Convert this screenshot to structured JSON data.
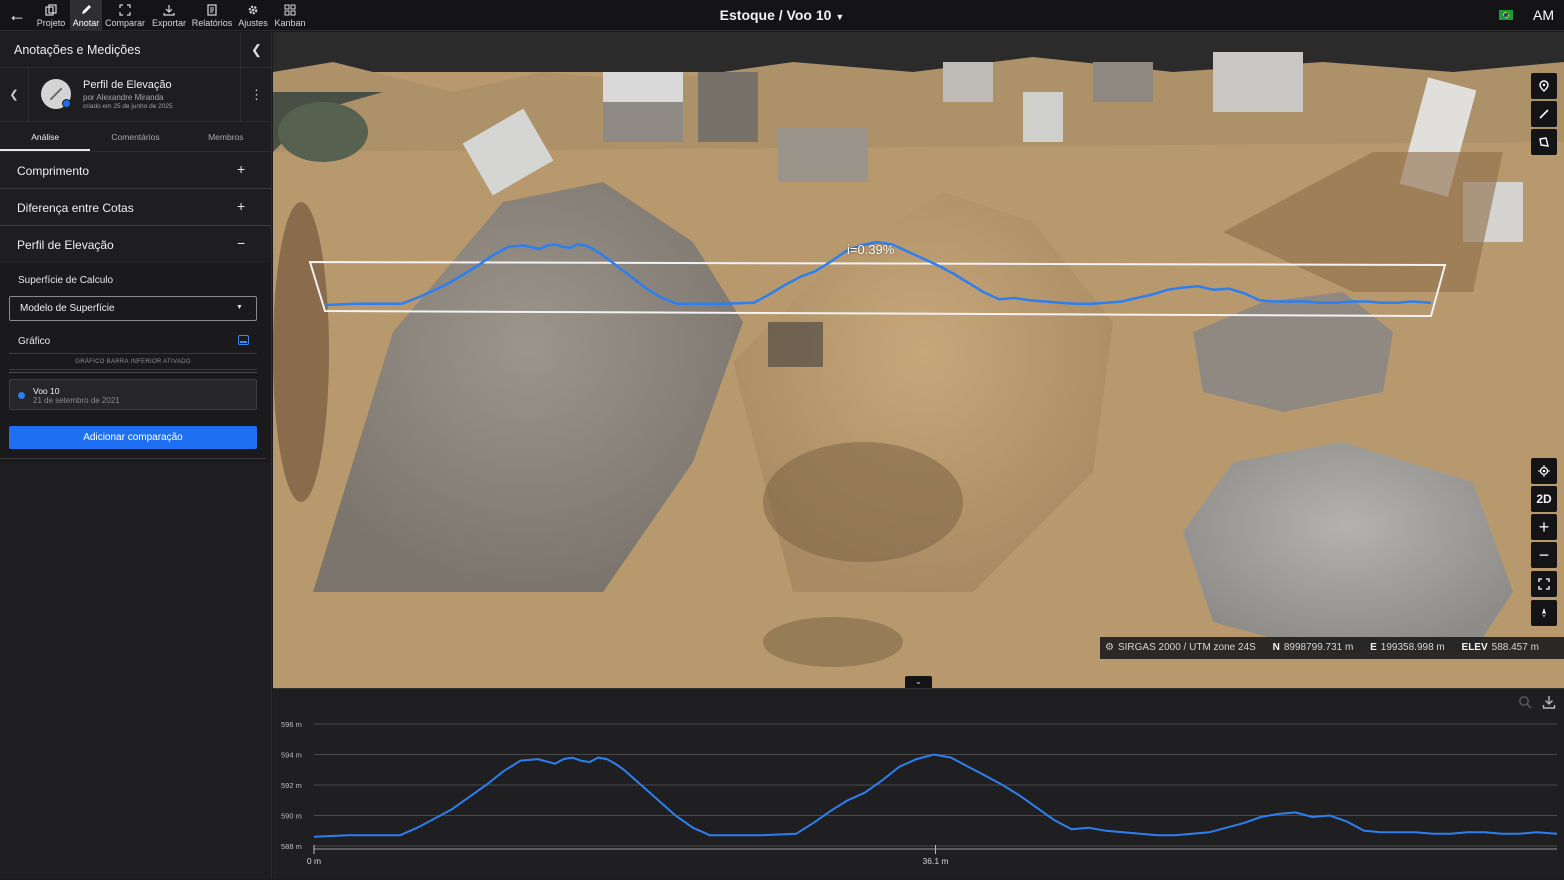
{
  "topbar": {
    "tools": [
      {
        "id": "projeto",
        "label": "Projeto",
        "icon": "copy-icon"
      },
      {
        "id": "anotar",
        "label": "Anotar",
        "icon": "pencil-icon",
        "active": true
      },
      {
        "id": "comparar",
        "label": "Comparar",
        "icon": "compare-icon"
      },
      {
        "id": "exportar",
        "label": "Exportar",
        "icon": "download-icon"
      },
      {
        "id": "relatorios",
        "label": "Relatórios",
        "icon": "report-icon"
      },
      {
        "id": "ajustes",
        "label": "Ajustes",
        "icon": "gear-icon"
      },
      {
        "id": "kanban",
        "label": "Kanban",
        "icon": "grid-icon"
      }
    ],
    "title": "Estoque / Voo 10",
    "avatar": "AM"
  },
  "sidebar": {
    "title": "Anotações e Medições",
    "annotation": {
      "name": "Perfil de Elevação",
      "author": "por  Alexandre Miranda",
      "created": "criado em 25 de junho de 2025"
    },
    "tabs": [
      {
        "label": "Análise",
        "active": true
      },
      {
        "label": "Comentários"
      },
      {
        "label": "Membros"
      }
    ],
    "sections": [
      {
        "label": "Comprimento",
        "sign": "+"
      },
      {
        "label": "Diferença entre Cotas",
        "sign": "+"
      },
      {
        "label": "Perfil de Elevação",
        "sign": "−"
      }
    ],
    "profile": {
      "surface_label": "Superfície de Calculo",
      "surface_value": "Modelo de Superfície",
      "graph_label": "Gráfico",
      "graph_note": "GRÁFICO BARRA INFERIOR ATIVADO",
      "flight_name": "Voo 10",
      "flight_date": "21 de setembro de 2021",
      "add_button": "Adicionar comparação"
    }
  },
  "viewport": {
    "slope_label": "i=0.39%",
    "view_mode": "2D",
    "crs": "SIRGAS 2000 / UTM zone 24S",
    "coords": {
      "n_key": "N",
      "n_value": "8998799.731 m",
      "e_key": "E",
      "e_value": "199358.998 m",
      "elev_key": "ELEV",
      "elev_value": "588.457 m"
    }
  },
  "colors": {
    "accent": "#1f6ff2",
    "profile_line": "#2d7ff0"
  },
  "chart_data": {
    "type": "line",
    "xlabel": "",
    "ylabel": "",
    "x_ticks": [
      {
        "value": 0,
        "label": "0 m"
      },
      {
        "value": 36.1,
        "label": "36.1 m"
      }
    ],
    "xlim": [
      0,
      72.2
    ],
    "y_ticks": [
      {
        "value": 588,
        "label": "588 m"
      },
      {
        "value": 590,
        "label": "590 m"
      },
      {
        "value": 592,
        "label": "592 m"
      },
      {
        "value": 594,
        "label": "594 m"
      },
      {
        "value": 596,
        "label": "596 m"
      }
    ],
    "ylim": [
      588,
      596
    ],
    "grid": true,
    "series": [
      {
        "x": [
          0,
          2,
          4,
          5,
          6,
          7,
          8,
          9,
          10,
          11,
          12,
          13,
          14,
          14.5,
          15,
          15.5,
          16,
          16.5,
          17,
          17.5,
          18,
          19,
          20,
          21,
          22,
          23,
          24,
          26,
          28,
          29,
          30,
          31,
          32,
          33,
          34,
          35,
          36,
          37,
          38,
          39,
          40,
          41,
          42,
          43,
          44,
          45,
          46,
          47,
          48,
          49,
          50,
          51,
          52,
          53,
          54,
          55,
          56,
          57,
          58,
          59,
          60,
          61,
          62,
          63,
          64,
          65,
          66,
          67,
          68,
          69,
          70,
          71,
          72.2
        ],
        "y": [
          588.6,
          588.7,
          588.7,
          588.7,
          589.2,
          589.8,
          590.4,
          591.2,
          592.0,
          592.9,
          593.6,
          593.7,
          593.4,
          593.7,
          593.8,
          593.6,
          593.5,
          593.8,
          593.7,
          593.4,
          593.0,
          592.0,
          591.0,
          590.0,
          589.2,
          588.7,
          588.7,
          588.7,
          588.8,
          589.5,
          590.3,
          591.0,
          591.5,
          592.3,
          593.2,
          593.7,
          594.0,
          593.8,
          593.2,
          592.6,
          592.0,
          591.3,
          590.5,
          589.7,
          589.1,
          589.2,
          589.0,
          588.9,
          588.8,
          588.7,
          588.7,
          588.8,
          588.9,
          589.2,
          589.5,
          589.9,
          590.1,
          590.2,
          589.9,
          590.0,
          589.6,
          589.0,
          588.9,
          588.9,
          588.9,
          588.8,
          588.8,
          588.9,
          588.9,
          588.8,
          588.8,
          588.9,
          588.8
        ]
      }
    ]
  }
}
